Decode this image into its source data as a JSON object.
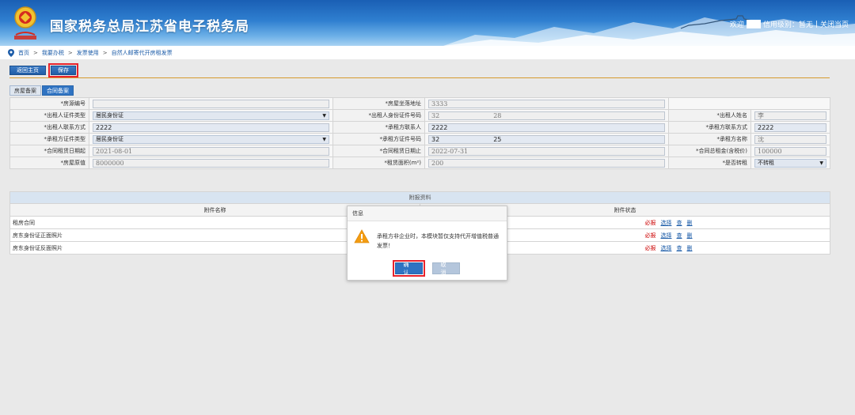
{
  "header": {
    "title": "国家税务总局江苏省电子税务局",
    "welcome": "欢迎",
    "credit_label": "信用级别：暂无",
    "divider": "|",
    "close_page": "关闭当页"
  },
  "breadcrumb": {
    "items": [
      "首页",
      "我要办税",
      "发票使用",
      "自然人邮寄代开房租发票"
    ],
    "separator": ">"
  },
  "toolbar": {
    "back_label": "返回主页",
    "save_label": "保存"
  },
  "tabs": [
    {
      "label": "房屋备案"
    },
    {
      "label": "合同备案"
    }
  ],
  "form": {
    "rows": [
      {
        "c1_label": "*房源编号",
        "c1_value": "",
        "c2_label": "*房屋坐落地址",
        "c2_value": "3333"
      },
      {
        "c1_label": "*出租人证件类型",
        "c1_value": "居民身份证",
        "c2_label": "*出租人身份证件号码",
        "c2_value": "32",
        "c2_value_b": "28",
        "c3_label": "*出租人姓名",
        "c3_value": "李"
      },
      {
        "c1_label": "*出租人联系方式",
        "c1_value": "2222",
        "c2_label": "*承租方联系人",
        "c2_value": "2222",
        "c3_label": "*承租方联系方式",
        "c3_value": "2222"
      },
      {
        "c1_label": "*承租方证件类型",
        "c1_value": "居民身份证",
        "c2_label": "*承租方证件号码",
        "c2_value": "32",
        "c2_value_b": "25",
        "c3_label": "*承租方名称",
        "c3_value": "沈"
      },
      {
        "c1_label": "*合同租赁日期起",
        "c1_value": "2021-08-01",
        "c2_label": "*合同租赁日期止",
        "c2_value": "2022-07-31",
        "c3_label": "*合同总租金(含税价)",
        "c3_value": "100000"
      },
      {
        "c1_label": "*房屋原值",
        "c1_value": "8000000",
        "c2_label": "*租赁面积(m²)",
        "c2_value": "200",
        "c3_label": "*是否转租",
        "c3_value": "不转租"
      }
    ]
  },
  "attachments": {
    "title": "附报资料",
    "col_name": "附件名称",
    "col_status": "附件状态",
    "items": [
      {
        "name": "租房合同",
        "required": "必报",
        "select": "选择",
        "view": "查",
        "del": "删"
      },
      {
        "name": "房东身份证正面照片",
        "required": "必报",
        "select": "选择",
        "view": "查",
        "del": "删"
      },
      {
        "name": "房东身份证反面照片",
        "required": "必报",
        "select": "选择",
        "view": "查",
        "del": "删"
      }
    ]
  },
  "modal": {
    "title": "信息",
    "message": "承租方非企业时，本模块暂仅支持代开增值税普通发票！",
    "ok_label": "确认",
    "cancel_label": "取消"
  },
  "colors": {
    "brand_blue": "#2f73c2",
    "highlight_red": "#e8232c",
    "accent_line": "#d69a2e"
  }
}
